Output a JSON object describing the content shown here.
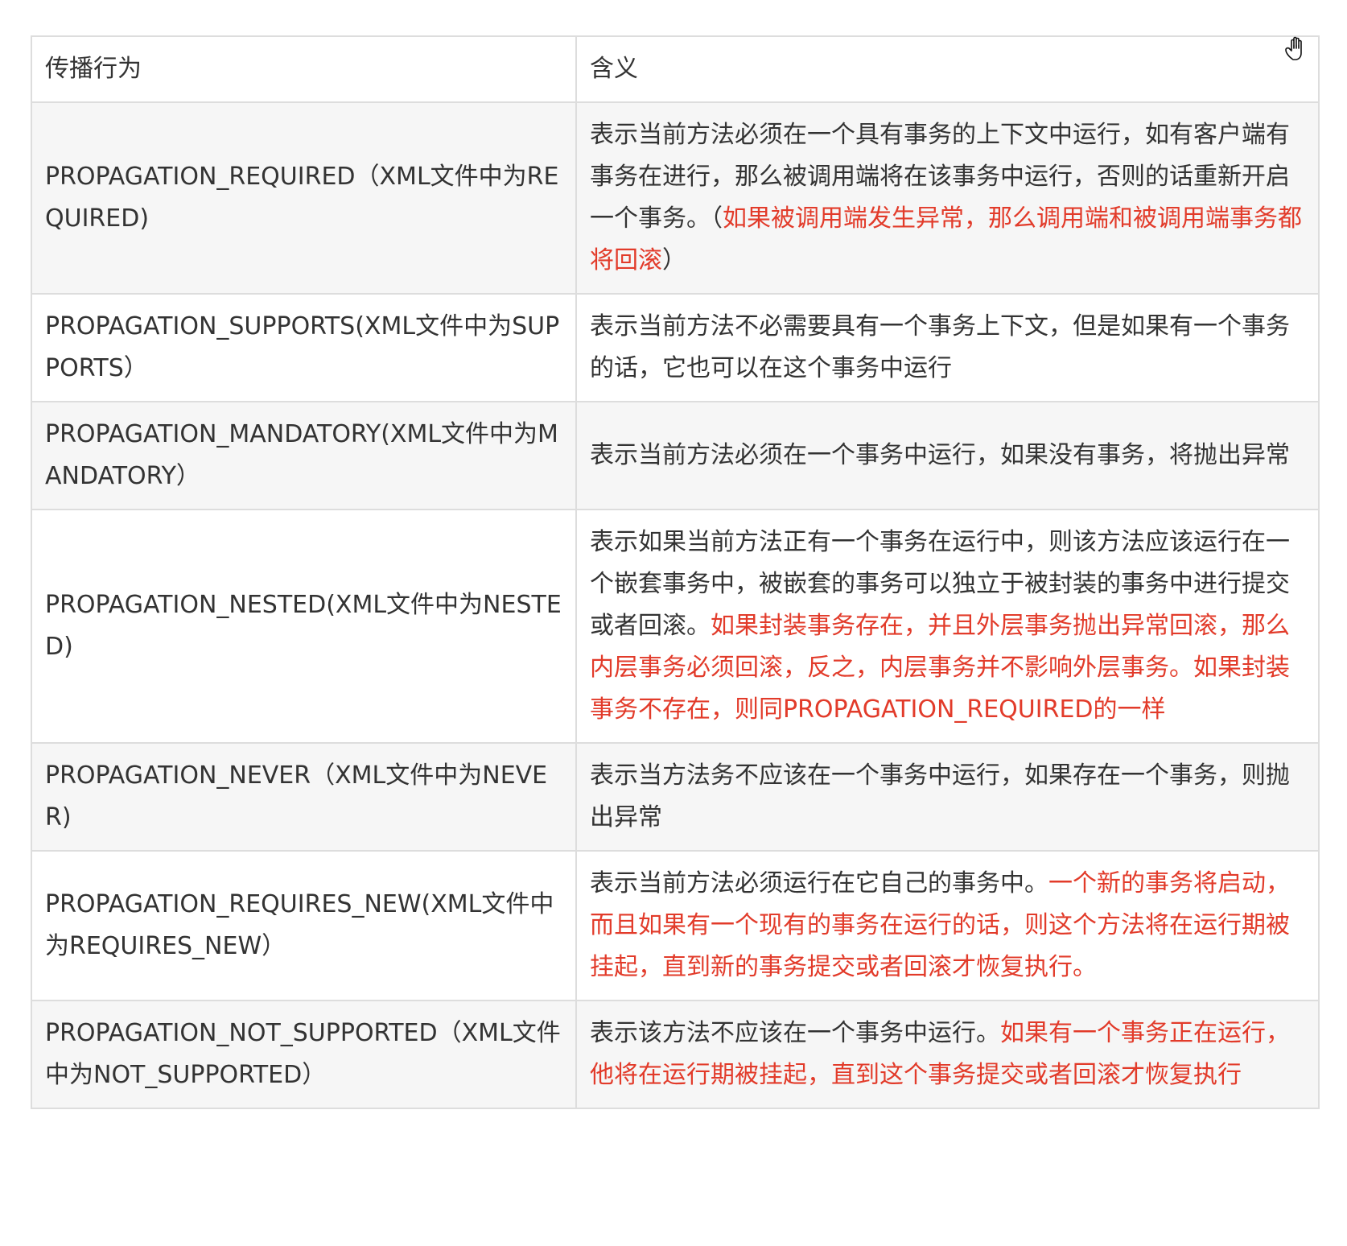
{
  "table": {
    "header": {
      "name": "传播行为",
      "meaning": "含义"
    },
    "rows": [
      {
        "name": "PROPAGATION_REQUIRED（XML文件中为REQUIRED)",
        "desc": "表示当前方法必须在一个具有事务的上下文中运行，如有客户端有事务在进行，那么被调用端将在该事务中运行，否则的话重新开启一个事务。（",
        "highlight": "如果被调用端发生异常，那么调用端和被调用端事务都将回滚",
        "tail": "）"
      },
      {
        "name": "PROPAGATION_SUPPORTS(XML文件中为SUPPORTS）",
        "desc": "表示当前方法不必需要具有一个事务上下文，但是如果有一个事务的话，它也可以在这个事务中运行"
      },
      {
        "name": "PROPAGATION_MANDATORY(XML文件中为MANDATORY）",
        "desc": "表示当前方法必须在一个事务中运行，如果没有事务，将抛出异常"
      },
      {
        "name": "PROPAGATION_NESTED(XML文件中为NESTED)",
        "desc": "表示如果当前方法正有一个事务在运行中，则该方法应该运行在一个嵌套事务中，被嵌套的事务可以独立于被封装的事务中进行提交或者回滚。",
        "highlight": "如果封装事务存在，并且外层事务抛出异常回滚，那么内层事务必须回滚，反之，内层事务并不影响外层事务。如果封装事务不存在，则同PROPAGATION_REQUIRED的一样"
      },
      {
        "name": "PROPAGATION_NEVER（XML文件中为NEVER)",
        "desc": "表示当方法务不应该在一个事务中运行，如果存在一个事务，则抛出异常"
      },
      {
        "name": "PROPAGATION_REQUIRES_NEW(XML文件中为REQUIRES_NEW）",
        "desc": "表示当前方法必须运行在它自己的事务中。",
        "highlight": "一个新的事务将启动，而且如果有一个现有的事务在运行的话，则这个方法将在运行期被挂起，直到新的事务提交或者回滚才恢复执行。"
      },
      {
        "name": "PROPAGATION_NOT_SUPPORTED（XML文件中为NOT_SUPPORTED）",
        "desc": "表示该方法不应该在一个事务中运行。",
        "highlight": "如果有一个事务正在运行，他将在运行期被挂起，直到这个事务提交或者回滚才恢复执行"
      }
    ]
  },
  "colors": {
    "highlight": "#e23b2a",
    "text": "#333333",
    "border": "#dddddd",
    "stripe": "#f6f6f6"
  },
  "cursor_icon": "hand-cursor-icon"
}
